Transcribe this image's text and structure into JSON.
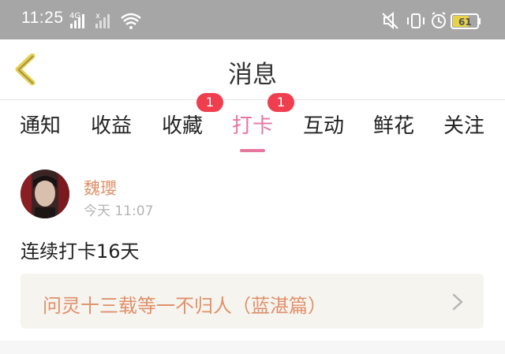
{
  "status_bar": {
    "time": "11:25",
    "network": "4G",
    "sim2_mark": "x",
    "battery": "61",
    "icons": [
      "signal-icon",
      "wifi-icon",
      "mute-icon",
      "vibrate-icon",
      "alarm-icon",
      "battery-icon"
    ]
  },
  "header": {
    "title": "消息",
    "back_icon": "chevron-left-icon",
    "accent": "#e8779c"
  },
  "tabs": [
    {
      "label": "通知",
      "badge": null,
      "active": false
    },
    {
      "label": "收益",
      "badge": null,
      "active": false
    },
    {
      "label": "收藏",
      "badge": "1",
      "active": false
    },
    {
      "label": "打卡",
      "badge": "1",
      "active": true
    },
    {
      "label": "互动",
      "badge": null,
      "active": false
    },
    {
      "label": "鲜花",
      "badge": null,
      "active": false
    },
    {
      "label": "关注",
      "badge": null,
      "active": false
    }
  ],
  "post": {
    "author": "魏瓔",
    "time": "今天 11:07",
    "content": "连续打卡16天",
    "book_title": "问灵十三载等一不归人（蓝湛篇）"
  }
}
